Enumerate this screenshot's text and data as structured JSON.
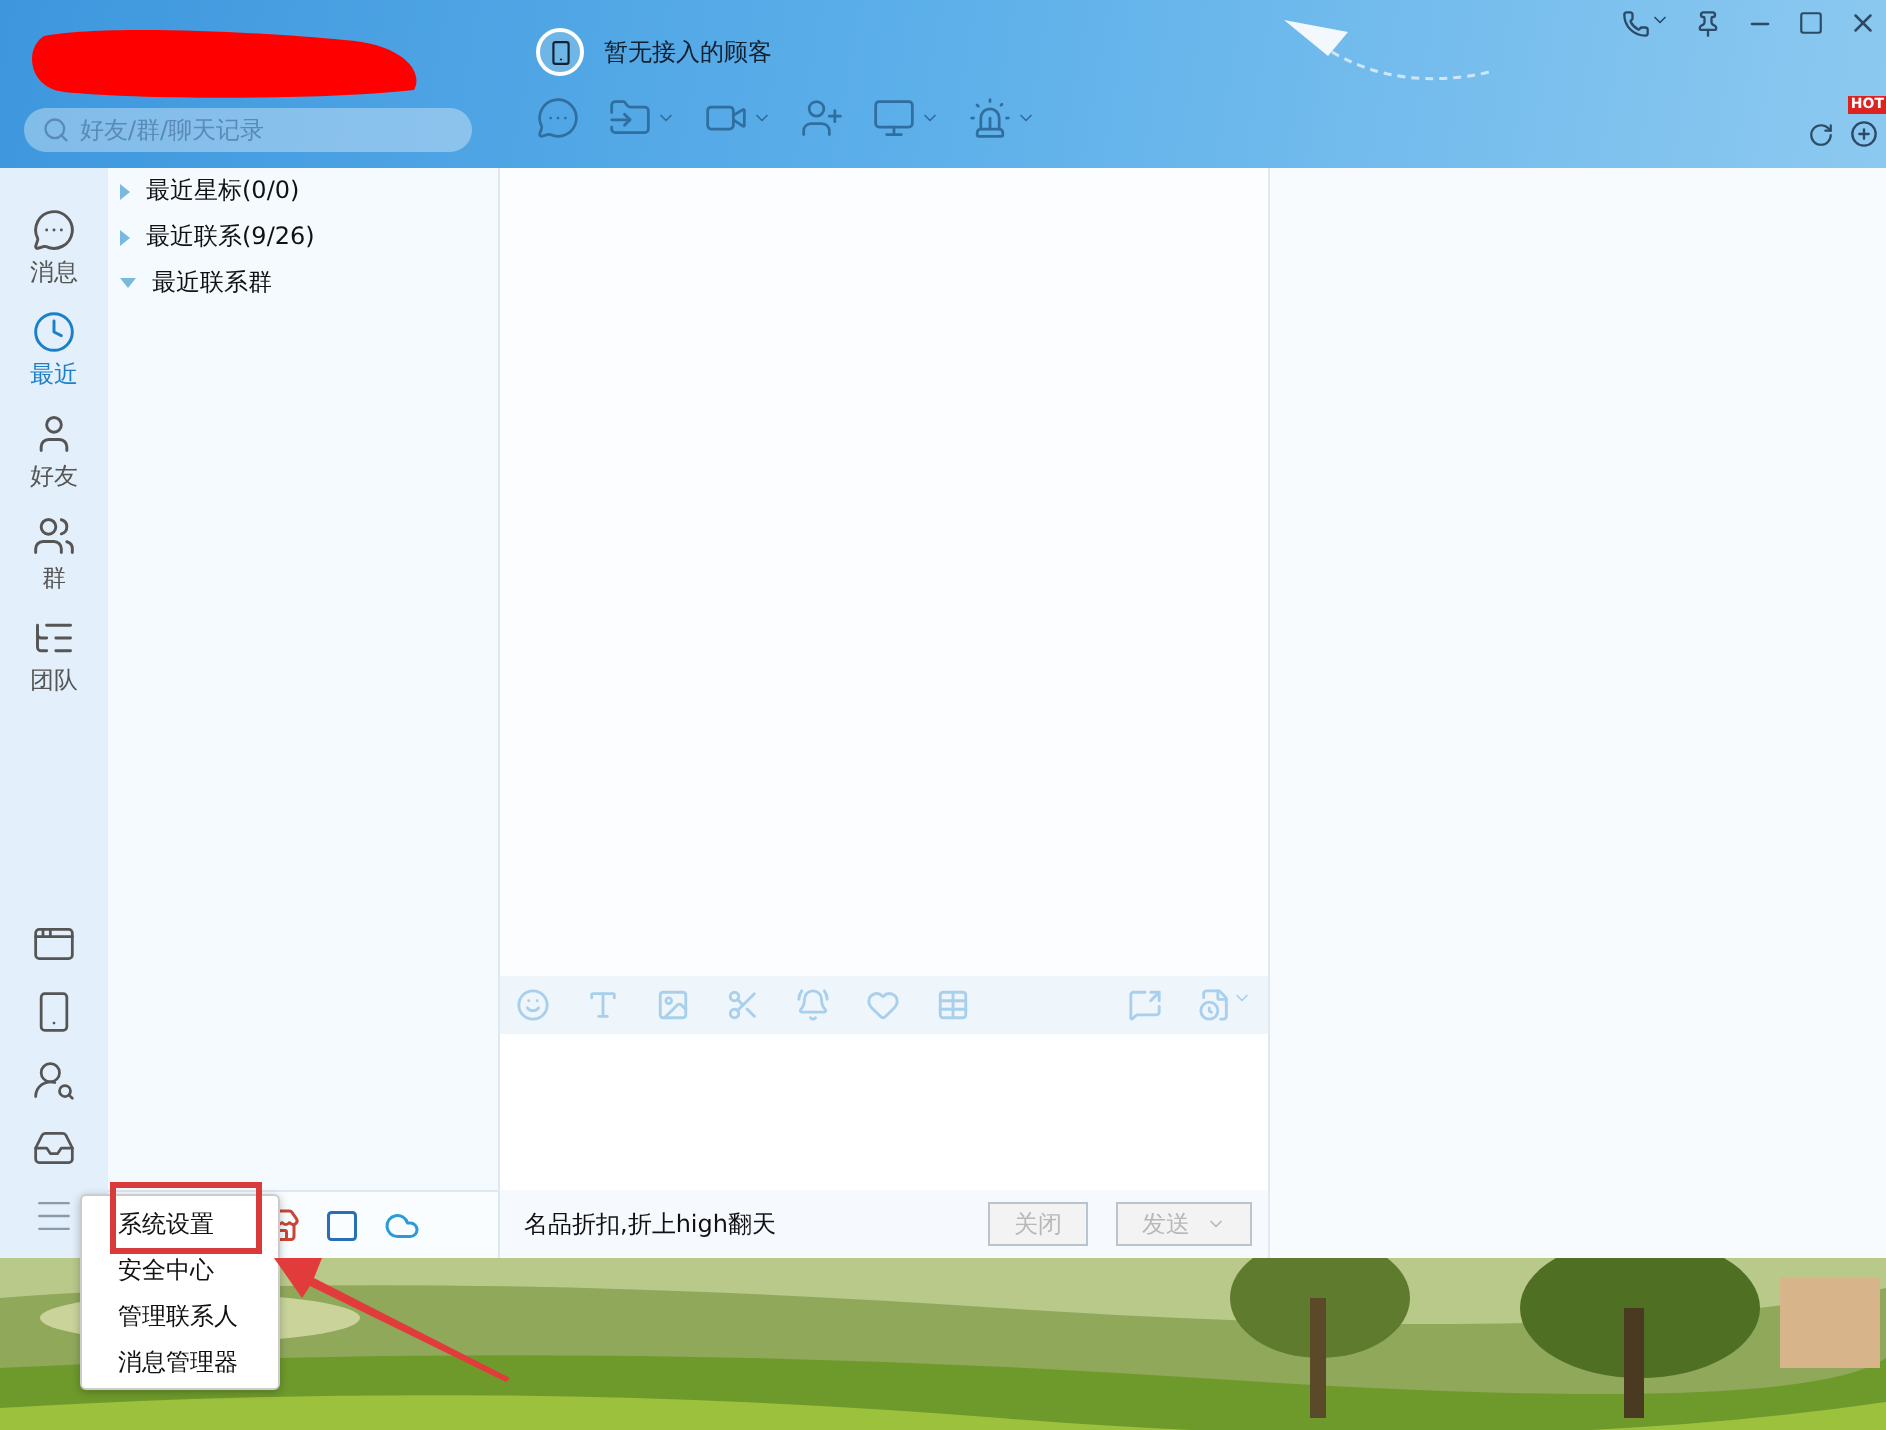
{
  "header": {
    "search": {
      "placeholder": "好友/群/聊天记录"
    },
    "customer_status": "暂无接入的顾客",
    "hot_badge": "HOT"
  },
  "nav": [
    {
      "label": "消息",
      "selected": false
    },
    {
      "label": "最近",
      "selected": true
    },
    {
      "label": "好友",
      "selected": false
    },
    {
      "label": "群",
      "selected": false
    },
    {
      "label": "团队",
      "selected": false
    }
  ],
  "groups": [
    {
      "label": "最近星标(0/0)",
      "expanded": false
    },
    {
      "label": "最近联系(9/26)",
      "expanded": false
    },
    {
      "label": "最近联系群",
      "expanded": true
    }
  ],
  "chat": {
    "ad_text": "名品折扣,折上high翻天",
    "buttons": [
      {
        "label": "关闭",
        "disabled": true
      },
      {
        "label": "发送",
        "disabled": true
      }
    ]
  },
  "menu": [
    {
      "label": "系统设置",
      "annotated": true
    },
    {
      "label": "安全中心",
      "annotated": false
    },
    {
      "label": "管理联系人",
      "annotated": false
    },
    {
      "label": "消息管理器",
      "annotated": false
    }
  ]
}
